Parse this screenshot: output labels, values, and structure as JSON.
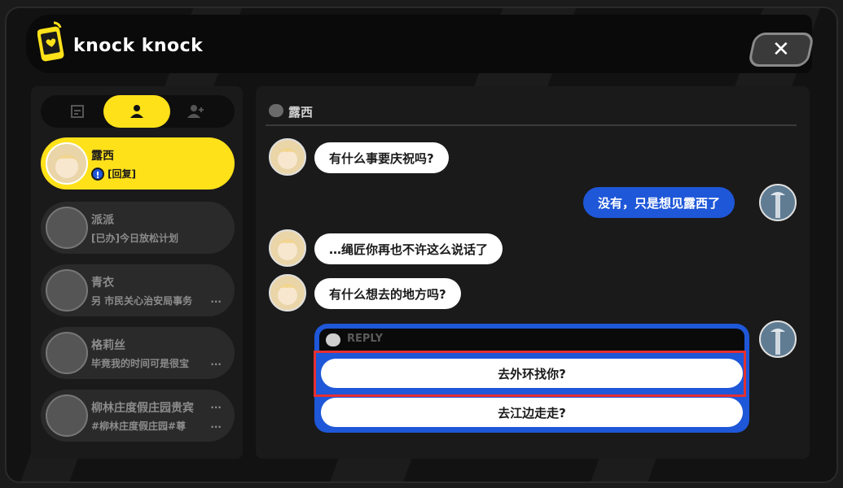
{
  "app": {
    "title": "knock knock",
    "close_icon": "close-icon"
  },
  "tabs": [
    {
      "name": "group-chat-icon"
    },
    {
      "name": "person-icon"
    },
    {
      "name": "add-friend-icon"
    }
  ],
  "contacts": [
    {
      "name": "露西",
      "preview": "[回复]",
      "alert": "!"
    },
    {
      "name": "派派",
      "preview": "[已办]今日放松计划"
    },
    {
      "name": "青衣",
      "preview": "另 市民关心治安局事务",
      "more": "..."
    },
    {
      "name": "格莉丝",
      "preview": "毕竟我的时间可是很宝",
      "more": "..."
    },
    {
      "name": "柳林庄度假庄园贵宾",
      "preview": "#柳林庄度假庄园#尊",
      "more": "..."
    }
  ],
  "chat": {
    "header": "露西",
    "messages": [
      {
        "from": "露西",
        "dir": "in",
        "text": "有什么事要庆祝吗?"
      },
      {
        "from": "me",
        "dir": "out",
        "text": "没有，只是想见露西了"
      },
      {
        "from": "露西",
        "dir": "in",
        "text": "…绳匠你再也不许这么说话了"
      },
      {
        "from": "露西",
        "dir": "in",
        "text": "有什么想去的地方吗?"
      }
    ],
    "reply": {
      "label": "REPLY",
      "options": [
        "去外环找你?",
        "去江边走走?"
      ]
    }
  },
  "colors": {
    "accent": "#ffe11a",
    "outgoing": "#1e57d8",
    "highlight": "#e53030"
  }
}
